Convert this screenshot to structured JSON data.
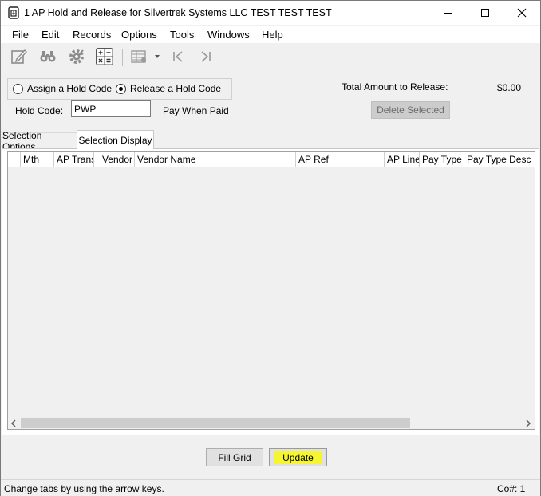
{
  "window": {
    "title": "1 AP Hold and Release for Silvertrek Systems LLC TEST TEST TEST",
    "controls": [
      "minimize",
      "maximize",
      "close"
    ]
  },
  "menu": [
    "File",
    "Edit",
    "Records",
    "Options",
    "Tools",
    "Windows",
    "Help"
  ],
  "toolbar": {
    "icons": [
      "edit-record-icon",
      "find-binoculars-icon",
      "settings-gear-icon",
      "calculator-icon",
      "grid-layout-icon",
      "dropdown-arrow-icon",
      "first-record-icon",
      "last-record-icon"
    ]
  },
  "hold": {
    "assign_label": "Assign a  Hold Code",
    "release_label": "Release a Hold Code",
    "selected": "release",
    "hold_code_label": "Hold Code:",
    "hold_code_value": "PWP",
    "hold_code_desc": "Pay When Paid",
    "total_label": "Total Amount to Release:",
    "total_value": "$0.00",
    "delete_selected": "Delete Selected"
  },
  "tabs": [
    {
      "label": "Selection Options",
      "active": false
    },
    {
      "label": "Selection Display",
      "active": true
    }
  ],
  "grid": {
    "columns": [
      "",
      "Mth",
      "AP Trans",
      "Vendor",
      "Vendor Name",
      "AP Ref",
      "AP Line",
      "Pay Type",
      "Pay Type Desc"
    ],
    "rows": []
  },
  "buttons": {
    "fill_grid": "Fill Grid",
    "update": "Update"
  },
  "highlight_color": "#f5f531",
  "status": {
    "message": "Change tabs by using the arrow keys.",
    "company": "Co#: 1"
  }
}
